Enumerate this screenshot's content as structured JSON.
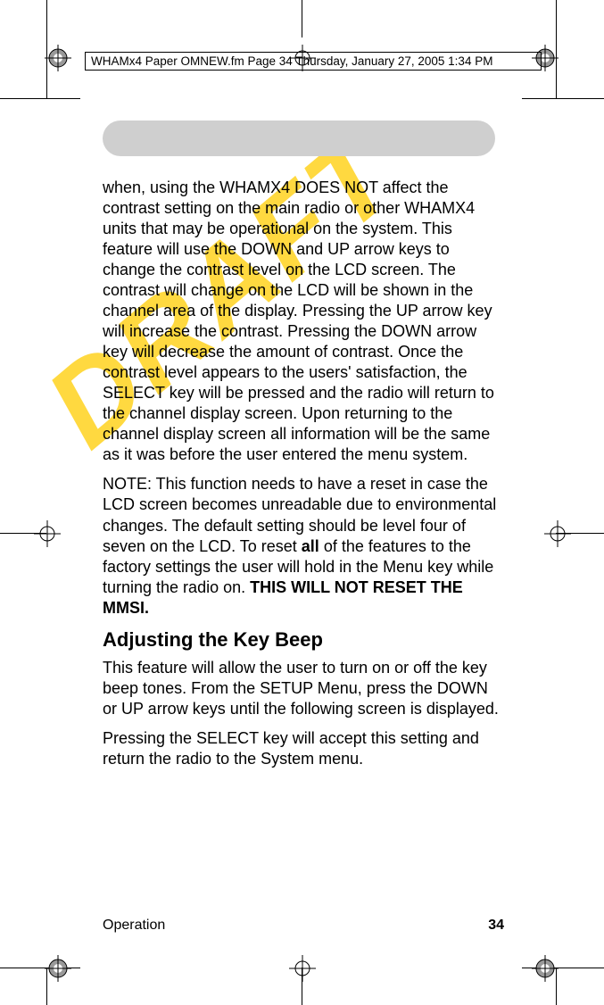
{
  "running_head": "WHAMx4 Paper OMNEW.fm  Page 34  Thursday, January 27, 2005  1:34 PM",
  "watermark": "DRAFT",
  "body": {
    "p1_a": "when, using the WHAMX4 DOES NOT affect the contrast setting on the main radio or other WHAMX4 units that may be operational on the system. This feature will use the DOWN and UP arrow keys to change the contrast level on the LCD screen.  The contrast will change on the LCD will be shown in the channel area of the display. Pressing the UP arrow key will increase the contrast. Pressing the DOWN arrow key will decrease the amount of contrast.  Once the contrast level appears to the users' satis­faction, the SELECT key will be pressed and the radio will return to the channel display screen.  Upon returning to the channel display screen all informa­tion will be the same as it was before the user entered the menu system.",
    "p2_a": "NOTE: This function needs to have a reset in case the LCD screen becomes unreadable due to envi­ronmental changes.  The default setting should be level four of seven on the LCD.  To reset ",
    "p2_bold1": "all",
    "p2_b": " of the features to the factory settings the user will hold in the Menu key while turning the radio on.  ",
    "p2_bold2": "THIS WILL NOT RESET THE MMSI.",
    "h2": "Adjusting the Key Beep",
    "p3": "This feature will allow the user to turn on or off the key beep tones. From the SETUP Menu, press the DOWN or UP arrow keys until the following screen is displayed.",
    "p4": "Pressing the SELECT key will accept this setting and return the radio to the System menu."
  },
  "footer": {
    "section": "Operation",
    "page": "34"
  }
}
